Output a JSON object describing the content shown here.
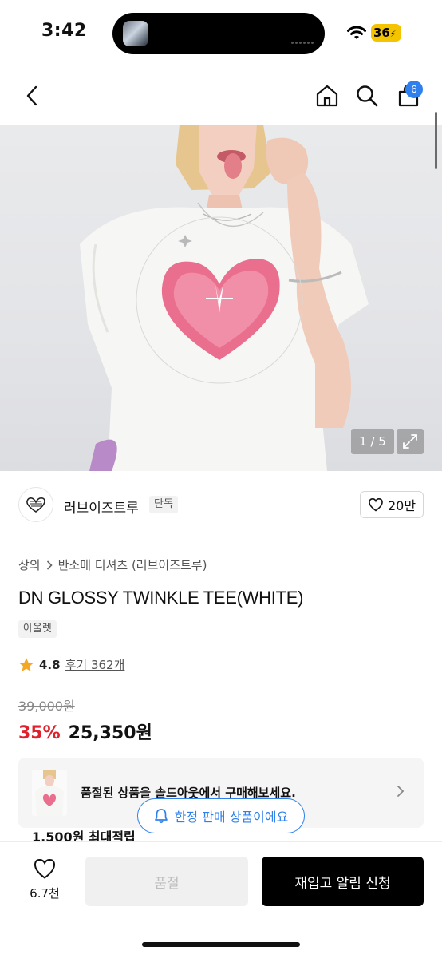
{
  "status_bar": {
    "time": "3:42",
    "battery": "36"
  },
  "nav": {
    "cart_count": "6"
  },
  "gallery": {
    "counter": "1 / 5"
  },
  "brand": {
    "name": "러브이즈트루",
    "exclusive_badge": "단독",
    "like_count": "20만"
  },
  "product": {
    "category": "상의",
    "subcategory": "반소매 티셔츠 (러브이즈트루)",
    "title": "DN GLOSSY TWINKLE TEE(WHITE)",
    "tag": "아울렛",
    "rating": "4.8",
    "reviews": "후기 362개",
    "original_price": "39,000원",
    "discount": "35%",
    "sale_price": "25,350원"
  },
  "soldout_banner": {
    "text": "품절된 상품을 솔드아웃에서 구매해보세요."
  },
  "limited_badge": {
    "text": "한정 판매 상품이에요"
  },
  "points": {
    "text": "1,500원 최대적립"
  },
  "bottom_bar": {
    "wish_count": "6.7천",
    "soldout_label": "품절",
    "restock_label": "재입고 알림 신청"
  },
  "colors": {
    "accent_blue": "#2f80ed",
    "discount_red": "#e0202a",
    "star": "#f5a623"
  }
}
